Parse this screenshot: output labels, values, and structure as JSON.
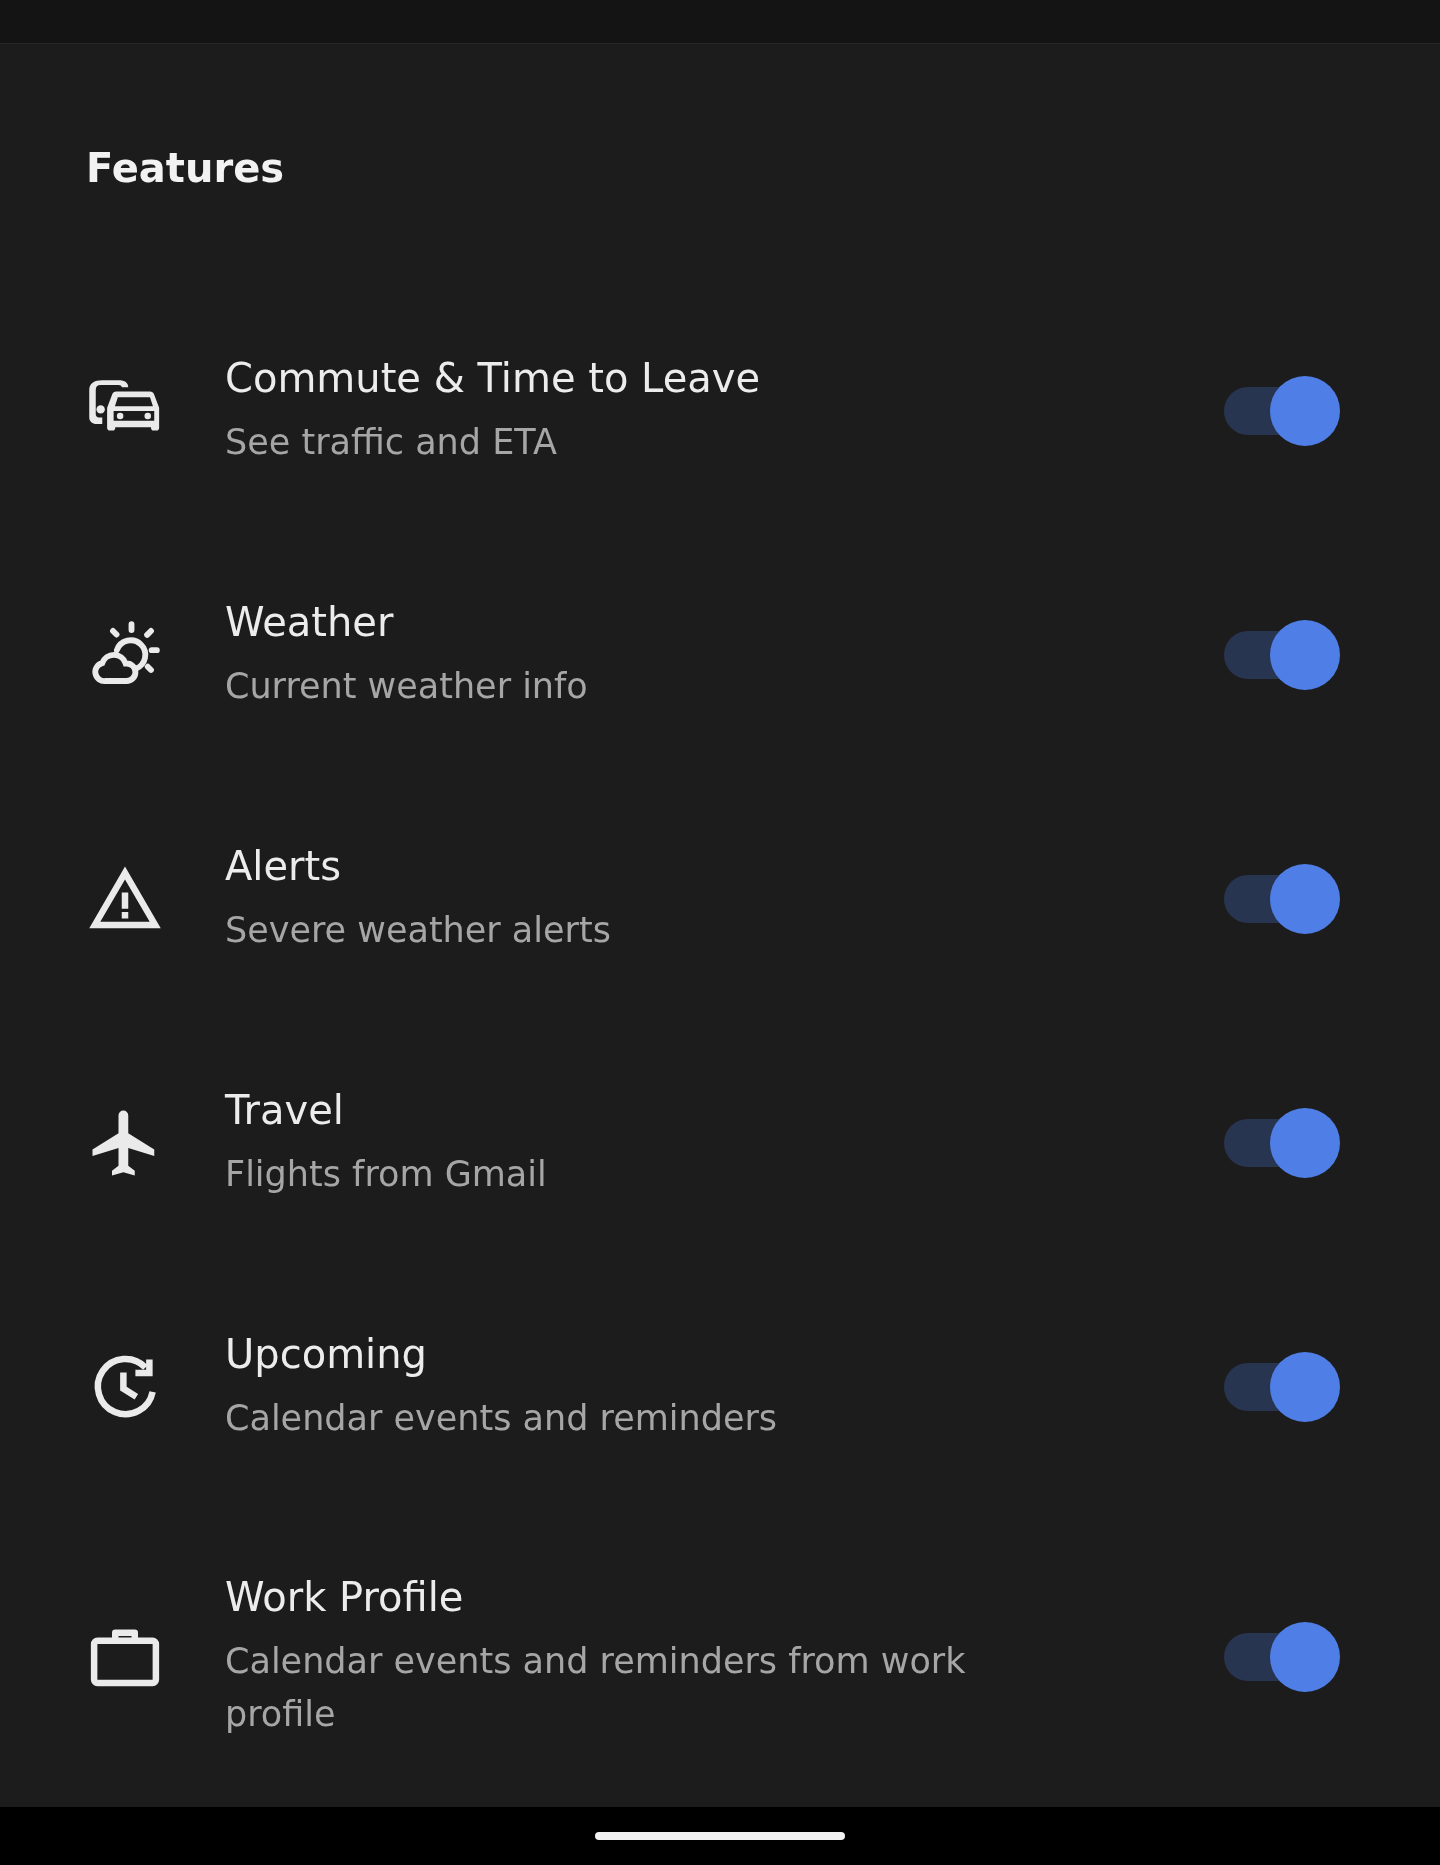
{
  "section_title": "Features",
  "features": [
    {
      "kind": "commute",
      "title": "Commute & Time to Leave",
      "subtitle": "See traffic and ETA",
      "on": true
    },
    {
      "kind": "weather",
      "title": "Weather",
      "subtitle": "Current weather info",
      "on": true
    },
    {
      "kind": "alert",
      "title": "Alerts",
      "subtitle": "Severe weather alerts",
      "on": true
    },
    {
      "kind": "flight",
      "title": "Travel",
      "subtitle": "Flights from Gmail",
      "on": true
    },
    {
      "kind": "upcoming",
      "title": "Upcoming",
      "subtitle": "Calendar events and reminders",
      "on": true
    },
    {
      "kind": "work",
      "title": "Work Profile",
      "subtitle": "Calendar events and reminders from work profile",
      "on": true
    }
  ]
}
